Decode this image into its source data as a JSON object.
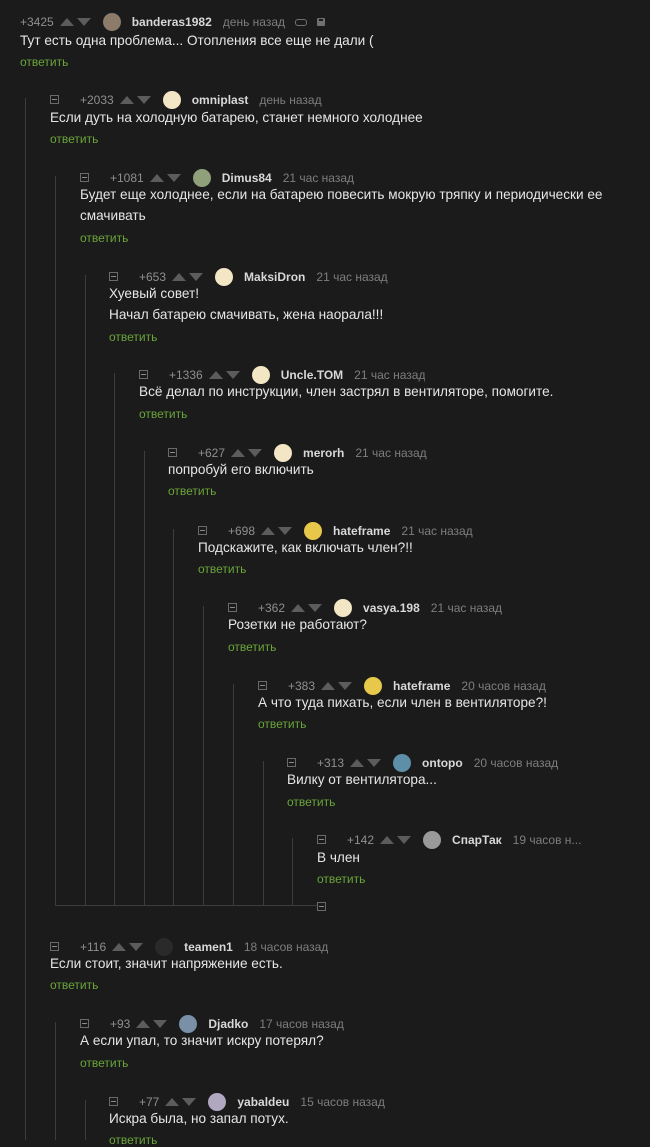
{
  "reply_label": "ответить",
  "comments": [
    {
      "rating": "+3425",
      "author": "banderas1982",
      "time": "день назад",
      "avatar_color": "#8c7a6a",
      "text": "Тут есть одна проблема... Отопления все еще не дали ("
    },
    {
      "rating": "+2033",
      "author": "omniplast",
      "time": "день назад",
      "avatar_color": "#f2e6c4",
      "text": "Если дуть на холодную батарею, станет немного холоднее"
    },
    {
      "rating": "+1081",
      "author": "Dimus84",
      "time": "21 час назад",
      "avatar_color": "#8fa07a",
      "text": "Будет еще холоднее, если на батарею повесить мокрую тряпку и периодически ее\nсмачивать"
    },
    {
      "rating": "+653",
      "author": "MaksiDron",
      "time": "21 час назад",
      "avatar_color": "#f2e6c4",
      "text": "Хуевый совет!\nНачал батарею смачивать, жена наорала!!!"
    },
    {
      "rating": "+1336",
      "author": "Uncle.TOM",
      "time": "21 час назад",
      "avatar_color": "#f2e6c4",
      "text": "Всё делал по инструкции, член застрял в вентиляторе, помогите."
    },
    {
      "rating": "+627",
      "author": "merorh",
      "time": "21 час назад",
      "avatar_color": "#f2e6c4",
      "text": "попробуй его включить"
    },
    {
      "rating": "+698",
      "author": "hateframe",
      "time": "21 час назад",
      "avatar_color": "#e8c84a",
      "text": "Подскажите, как включать член?!!"
    },
    {
      "rating": "+362",
      "author": "vasya.198",
      "time": "21 час назад",
      "avatar_color": "#f2e6c4",
      "text": "Розетки не работают?"
    },
    {
      "rating": "+383",
      "author": "hateframe",
      "time": "20 часов назад",
      "avatar_color": "#e8c84a",
      "text": "А что туда пихать, если член в вентиляторе?!"
    },
    {
      "rating": "+313",
      "author": "ontopo",
      "time": "20 часов назад",
      "avatar_color": "#5d8fa8",
      "text": "Вилку от вентилятора..."
    },
    {
      "rating": "+142",
      "author": "СпарТак",
      "time": "19 часов н...",
      "avatar_color": "#9a9a9a",
      "text": "В член"
    },
    {
      "rating": "+116",
      "author": "teamen1",
      "time": "18 часов назад",
      "avatar_color": "#2a2a2a",
      "text": "Если стоит, значит напряжение есть."
    },
    {
      "rating": "+93",
      "author": "Djadko",
      "time": "17 часов назад",
      "avatar_color": "#7a8fa8",
      "text": "А если упал, то значит искру потерял?"
    },
    {
      "rating": "+77",
      "author": "yabaldeu",
      "time": "15 часов назад",
      "avatar_color": "#b0a8c0",
      "text": "Искра была, но запал потух."
    }
  ]
}
